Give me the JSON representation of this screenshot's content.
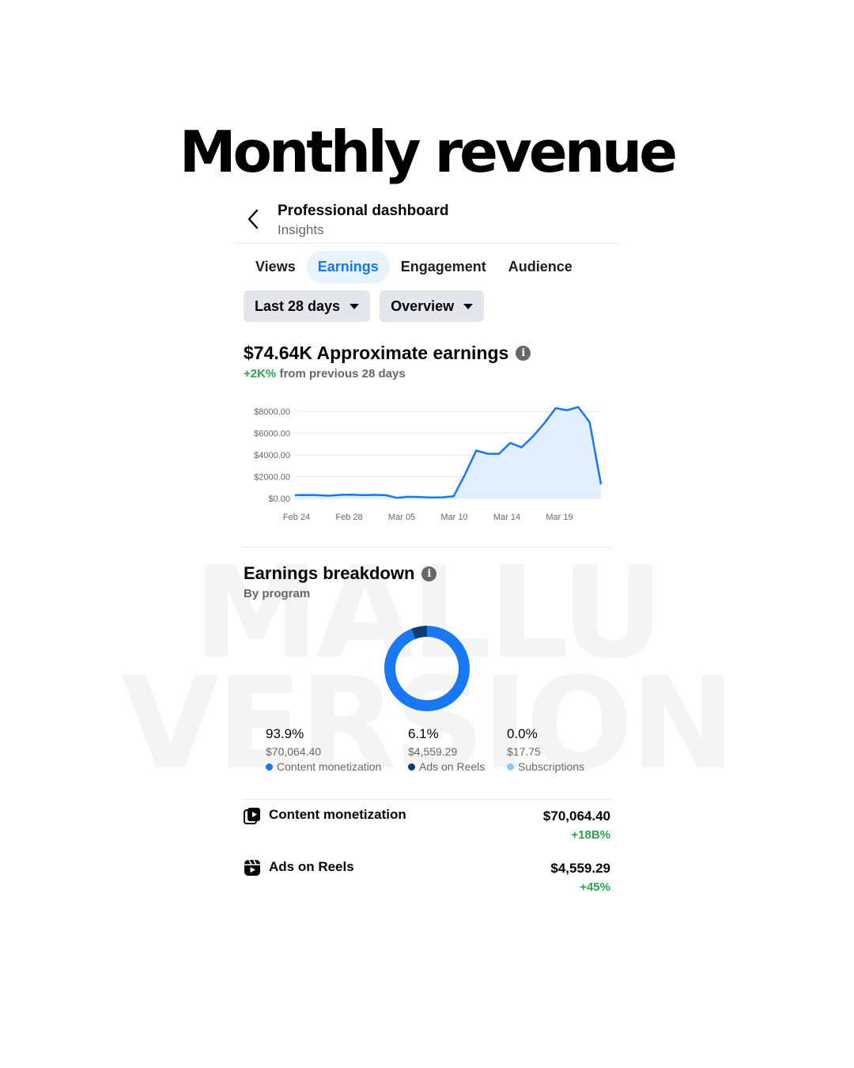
{
  "headline": "Monthly revenue",
  "watermark": {
    "line1": "MALLU",
    "line2": "VERSION"
  },
  "header": {
    "title": "Professional dashboard",
    "subtitle": "Insights"
  },
  "tabs": [
    {
      "label": "Views",
      "active": false
    },
    {
      "label": "Earnings",
      "active": true
    },
    {
      "label": "Engagement",
      "active": false
    },
    {
      "label": "Audience",
      "active": false
    }
  ],
  "filters": {
    "period": "Last 28 days",
    "view": "Overview"
  },
  "earnings": {
    "headline": "$74.64K Approximate earnings",
    "change_value": "+2K%",
    "change_text": " from previous 28 days"
  },
  "chart_data": {
    "type": "area",
    "x_tick_labels": [
      "Feb 24",
      "Feb 28",
      "Mar 05",
      "Mar 10",
      "Mar 14",
      "Mar 19"
    ],
    "y_tick_labels": [
      "$0.00",
      "$2000.00",
      "$4000.00",
      "$6000.00",
      "$8000.00"
    ],
    "ylim": [
      0,
      8000
    ],
    "grid": true,
    "color": "#1877f2",
    "fill": "#e3eefc",
    "series": [
      {
        "values": [
          300,
          320,
          300,
          250,
          330,
          340,
          300,
          330,
          300,
          50,
          150,
          120,
          80,
          100,
          200,
          2200,
          4400,
          4100,
          4100,
          5100,
          4700,
          5700,
          6900,
          8300,
          8100,
          8400,
          7000,
          1300
        ]
      }
    ]
  },
  "breakdown": {
    "title": "Earnings breakdown",
    "subtitle": "By program",
    "items": [
      {
        "pct": "93.9%",
        "value": "$70,064.40",
        "name": "Content monetization",
        "share": 0.939,
        "color": "#1877f2"
      },
      {
        "pct": "6.1%",
        "value": "$4,559.29",
        "name": "Ads on Reels",
        "share": 0.061,
        "color": "#0b3d6e"
      },
      {
        "pct": "0.0%",
        "value": "$17.75",
        "name": "Subscriptions",
        "share": 0.0,
        "color": "#8cc7f5"
      }
    ]
  },
  "programs": [
    {
      "name": "Content monetization",
      "value": "$70,064.40",
      "change": "+18B%",
      "icon": "content-monetization-icon"
    },
    {
      "name": "Ads on Reels",
      "value": "$4,559.29",
      "change": "+45%",
      "icon": "reels-icon"
    }
  ]
}
